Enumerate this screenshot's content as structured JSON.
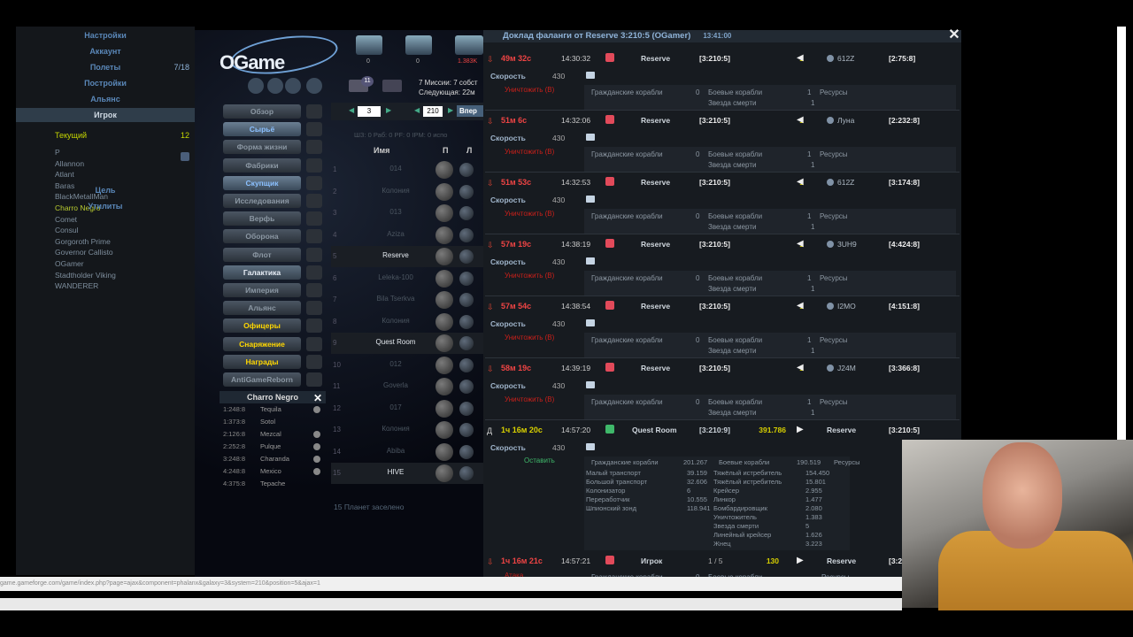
{
  "left_menu": {
    "items": [
      {
        "label": "Настройки"
      },
      {
        "label": "Аккаунт"
      },
      {
        "label": "Полеты",
        "count": "7/18"
      },
      {
        "label": "Постройки"
      },
      {
        "label": "Альянс"
      },
      {
        "label": "Игрок",
        "active": true
      }
    ],
    "current_label": "Текущий",
    "current_count": "12",
    "players_header": "Р",
    "players": [
      "Allannon",
      "Atlant",
      "Baras",
      "BlackMetallMan",
      "Charro Negro",
      "Comet",
      "Consul",
      "Gorgoroth Prime",
      "Governor Callisto",
      "OGamer",
      "Stadtholder Viking",
      "WANDERER"
    ],
    "bottom_items": [
      "Цель",
      "Утилиты"
    ]
  },
  "game": {
    "logo": "OGame",
    "res_values": [
      "0",
      "0",
      "1.383K"
    ],
    "messages_count": "11",
    "missions": "7 Миссии: 7 собст",
    "next": "Следующая: 22м",
    "menu": [
      {
        "label": "Обзор",
        "style": ""
      },
      {
        "label": "Сырьё",
        "style": "b"
      },
      {
        "label": "Форма жизни",
        "style": ""
      },
      {
        "label": "Фабрики",
        "style": ""
      },
      {
        "label": "Скупщик",
        "style": "b"
      },
      {
        "label": "Исследования",
        "style": ""
      },
      {
        "label": "Верфь",
        "style": ""
      },
      {
        "label": "Оборона",
        "style": ""
      },
      {
        "label": "Флот",
        "style": ""
      },
      {
        "label": "Галактика",
        "style": "w"
      },
      {
        "label": "Империя",
        "style": ""
      },
      {
        "label": "Альянс",
        "style": ""
      },
      {
        "label": "Офицеры",
        "style": "y"
      },
      {
        "label": "Снаряжение",
        "style": "y"
      },
      {
        "label": "Награды",
        "style": "y"
      },
      {
        "label": "AntiGameReborn",
        "style": ""
      }
    ]
  },
  "friends": {
    "title": "Charro Negro",
    "rows": [
      {
        "c": "1:248:8",
        "n": "Tequila"
      },
      {
        "c": "1:373:8",
        "n": "Sotol"
      },
      {
        "c": "2:126:8",
        "n": "Mezcal"
      },
      {
        "c": "2:252:8",
        "n": "Pulque"
      },
      {
        "c": "3:248:8",
        "n": "Charanda"
      },
      {
        "c": "4:248:8",
        "n": "Mexico"
      },
      {
        "c": "4:375:8",
        "n": "Tepache"
      }
    ]
  },
  "galaxy": {
    "galaxy": "3",
    "system": "210",
    "forward": "Впер",
    "stats": "ШЗ: 0   Раб: 0   PF: 0   IPM: 0   испо",
    "col_name": "Имя",
    "col_p": "П",
    "col_l": "Л",
    "rows": [
      {
        "n": "1",
        "name": "014"
      },
      {
        "n": "2",
        "name": "Колония"
      },
      {
        "n": "3",
        "name": "013"
      },
      {
        "n": "4",
        "name": "Aziza"
      },
      {
        "n": "5",
        "name": "Reserve",
        "hi": true
      },
      {
        "n": "6",
        "name": "Leleka-100"
      },
      {
        "n": "7",
        "name": "Bila Tserkva"
      },
      {
        "n": "8",
        "name": "Колония"
      },
      {
        "n": "9",
        "name": "Quest Room",
        "hi": true
      },
      {
        "n": "10",
        "name": "012"
      },
      {
        "n": "11",
        "name": "Goverla"
      },
      {
        "n": "12",
        "name": "017"
      },
      {
        "n": "13",
        "name": "Колония"
      },
      {
        "n": "14",
        "name": "Abiba"
      },
      {
        "n": "15",
        "name": "HIVE",
        "hi": true
      }
    ],
    "footer": "15 Планет заселено"
  },
  "report": {
    "title": "Доклад фаланги от Reserve 3:210:5 (OGamer)",
    "time": "13:41:00",
    "labels": {
      "speed": "Скорость",
      "destroy": "Уничтожить (В)",
      "civil": "Гражданские корабли",
      "battle": "Боевые корабли",
      "resources": "Ресурсы",
      "deathstar": "Звезда смерти",
      "keep": "Оставить"
    },
    "events": [
      {
        "tm": "49м 32с",
        "cl": "14:30:32",
        "who": "Reserve",
        "co": "[3:210:5]",
        "am": "1",
        "dst": "612Z",
        "dc": "[2:75:8]",
        "speed": "430",
        "civ": "0",
        "bat": "1",
        "ds": "1"
      },
      {
        "tm": "51м 6с",
        "cl": "14:32:06",
        "who": "Reserve",
        "co": "[3:210:5]",
        "am": "1",
        "dst": "Луна",
        "dc": "[2:232:8]",
        "speed": "430",
        "civ": "0",
        "bat": "1",
        "ds": "1"
      },
      {
        "tm": "51м 53с",
        "cl": "14:32:53",
        "who": "Reserve",
        "co": "[3:210:5]",
        "am": "1",
        "dst": "612Z",
        "dc": "[3:174:8]",
        "speed": "430",
        "civ": "0",
        "bat": "1",
        "ds": "1"
      },
      {
        "tm": "57м 19с",
        "cl": "14:38:19",
        "who": "Reserve",
        "co": "[3:210:5]",
        "am": "1",
        "dst": "3UH9",
        "dc": "[4:424:8]",
        "speed": "430",
        "civ": "0",
        "bat": "1",
        "ds": "1"
      },
      {
        "tm": "57м 54с",
        "cl": "14:38:54",
        "who": "Reserve",
        "co": "[3:210:5]",
        "am": "1",
        "dst": "I2MO",
        "dc": "[4:151:8]",
        "speed": "430",
        "civ": "0",
        "bat": "1",
        "ds": "1"
      },
      {
        "tm": "58м 19с",
        "cl": "14:39:19",
        "who": "Reserve",
        "co": "[3:210:5]",
        "am": "1",
        "dst": "J24M",
        "dc": "[3:366:8]",
        "speed": "430",
        "civ": "0",
        "bat": "1",
        "ds": "1"
      }
    ],
    "quest": {
      "ar": "Д",
      "tm": "1ч 16м 20с",
      "cl": "14:57:20",
      "who": "Quest Room",
      "co": "[3:210:9]",
      "am": "391.786",
      "dst": "Reserve",
      "dc": "[3:210:5]",
      "speed": "430",
      "civ_total": "201.267",
      "bat_total": "190.519",
      "civ": [
        [
          "Малый транспорт",
          "39.159"
        ],
        [
          "Большой транспорт",
          "32.606"
        ],
        [
          "Колонизатор",
          "6"
        ],
        [
          "Переработчик",
          "10.555"
        ],
        [
          "Шпионский зонд",
          "118.941"
        ]
      ],
      "bat": [
        [
          "Тяжёлый истребитель",
          "154.450"
        ],
        [
          "Тяжёлый истребитель",
          "15.801"
        ],
        [
          "Крейсер",
          "2.955"
        ],
        [
          "Линкор",
          "1.477"
        ],
        [
          "Бомбардировщик",
          "2.080"
        ],
        [
          "Уничтожитель",
          "1.383"
        ],
        [
          "Звезда смерти",
          "5"
        ],
        [
          "Линейный крейсер",
          "1.626"
        ],
        [
          "Жнец",
          "3.223"
        ]
      ]
    },
    "last": {
      "tm": "1ч 16м 21с",
      "cl": "14:57:21",
      "who": "Игрок",
      "co": "1 / 5",
      "am": "130",
      "dst": "Reserve",
      "dc": "[3:2",
      "atk": "Атака",
      "civ": "Гражданские корабли",
      "zero": "0",
      "bat": "Боевые корабли",
      "res": "Ресурсы"
    }
  },
  "status_url": "game.gameforge.com/game/index.php?page=ajax&component=phalanx&galaxy=3&system=210&position=5&ajax=1"
}
